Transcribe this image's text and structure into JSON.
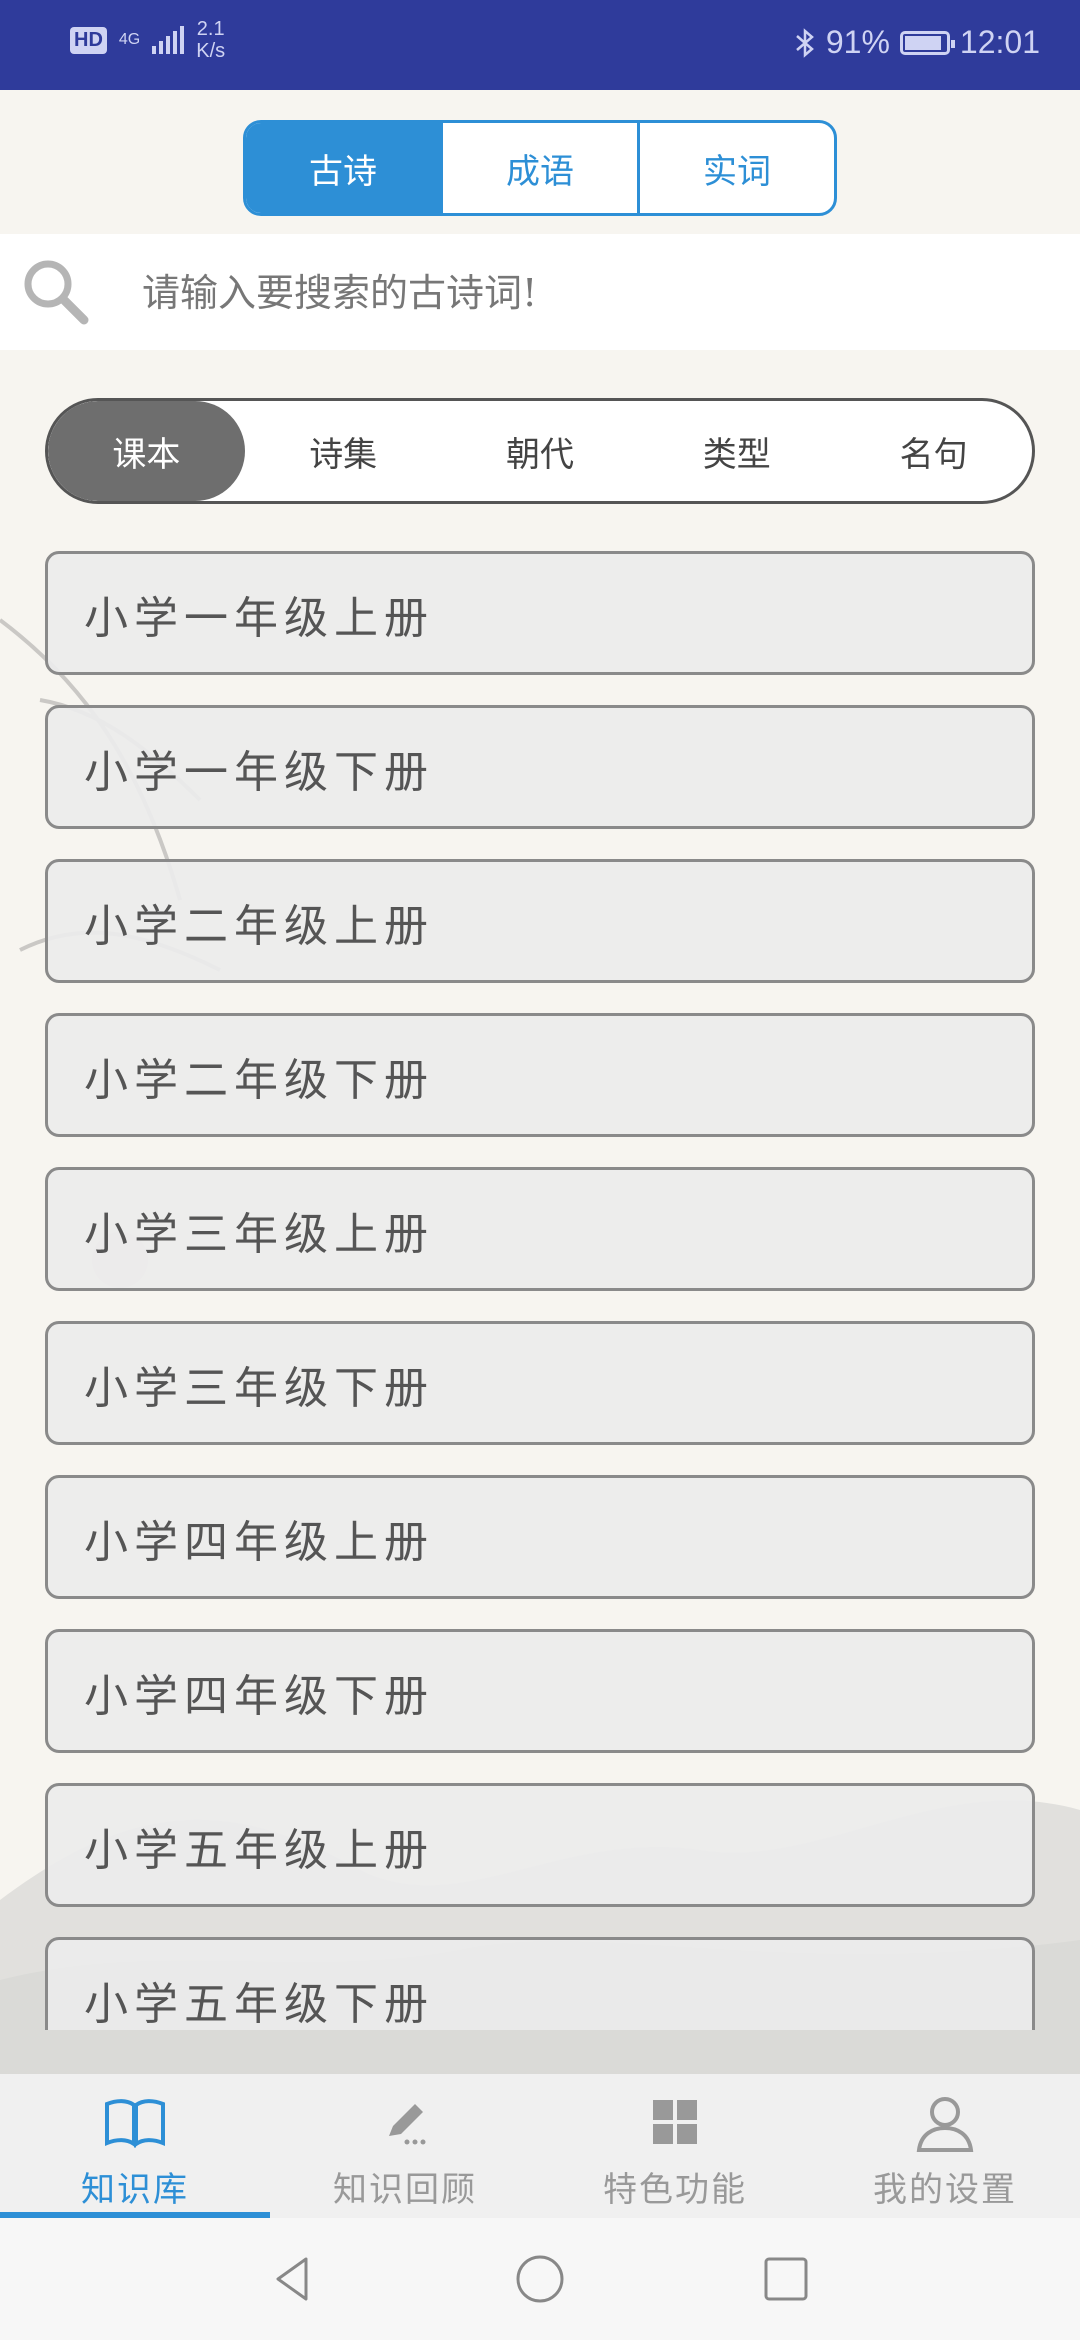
{
  "status_bar": {
    "hd": "HD",
    "network": "4G",
    "speed_value": "2.1",
    "speed_unit": "K/s",
    "battery": "91%",
    "time": "12:01",
    "battery_level": 0.91,
    "bar_color": "#2f3b9b"
  },
  "top_tabs": [
    {
      "label": "古诗",
      "active": true
    },
    {
      "label": "成语",
      "active": false
    },
    {
      "label": "实词",
      "active": false
    }
  ],
  "search": {
    "placeholder": "请输入要搜索的古诗词!",
    "icon": "search-icon"
  },
  "category_tabs": [
    {
      "label": "课本",
      "active": true
    },
    {
      "label": "诗集",
      "active": false
    },
    {
      "label": "朝代",
      "active": false
    },
    {
      "label": "类型",
      "active": false
    },
    {
      "label": "名句",
      "active": false
    }
  ],
  "list": [
    "小学一年级上册",
    "小学一年级下册",
    "小学二年级上册",
    "小学二年级下册",
    "小学三年级上册",
    "小学三年级下册",
    "小学四年级上册",
    "小学四年级下册",
    "小学五年级上册",
    "小学五年级下册"
  ],
  "bottom_nav": [
    {
      "label": "知识库",
      "icon": "book-icon",
      "active": true
    },
    {
      "label": "知识回顾",
      "icon": "pencil-icon",
      "active": false
    },
    {
      "label": "特色功能",
      "icon": "grid-icon",
      "active": false
    },
    {
      "label": "我的设置",
      "icon": "user-icon",
      "active": false
    }
  ],
  "colors": {
    "accent": "#2d8fd6",
    "status_bar": "#2f3b9b",
    "active_category": "#6e6e6e"
  }
}
